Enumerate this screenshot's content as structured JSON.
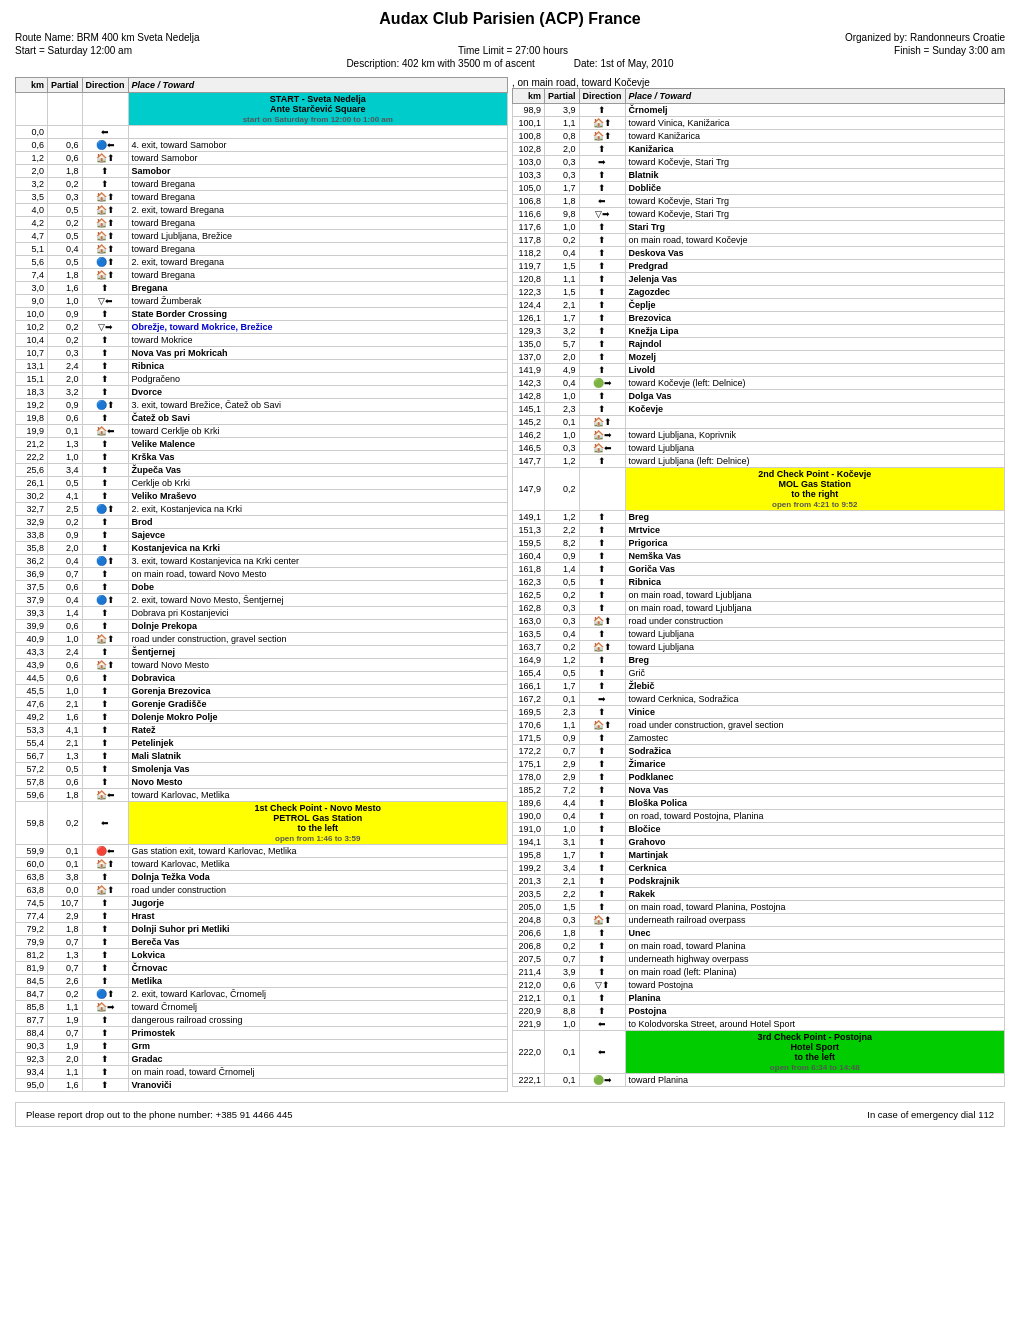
{
  "header": {
    "title": "Audax Club Parisien (ACP) France",
    "route": "Route Name: BRM 400 km Sveta Nedelja",
    "organized": "Organized by: Randonneurs Croatie",
    "start": "Start = Saturday 12:00 am",
    "time_limit": "Time Limit = 27:00 hours",
    "finish": "Finish = Sunday 3:00 am",
    "description": "Description: 402 km with 3500 m of ascent",
    "date": "Date: 1st of May, 2010"
  },
  "table_header": {
    "km": "km",
    "partial": "Partial",
    "direction": "Direction",
    "place": "Place / Toward"
  },
  "footer": {
    "left": "Please report drop out to the phone number: +385 91 4466 445",
    "right": "In case of emergency dial 112"
  }
}
